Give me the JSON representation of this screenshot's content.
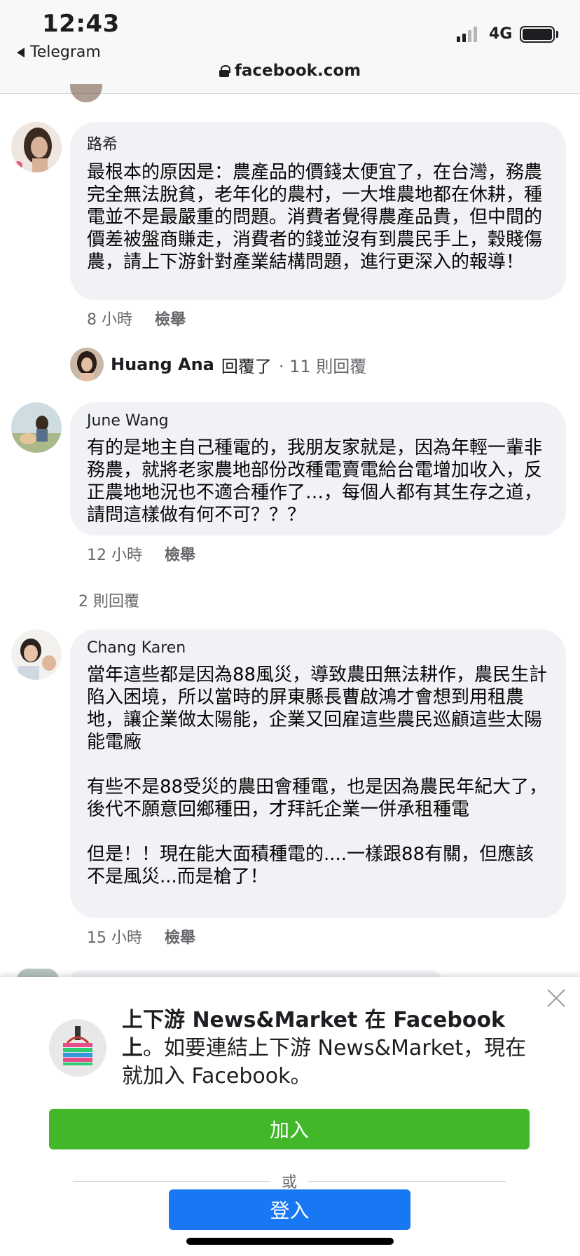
{
  "status_bar": {
    "time": "12:43",
    "back_app": "Telegram",
    "network": "4G"
  },
  "browser": {
    "url": "facebook.com"
  },
  "comments": [
    {
      "author": "路希",
      "text": "最根本的原因是：農產品的價錢太便宜了，在台灣，務農完全無法脫貧，老年化的農村，一大堆農地都在休耕，種電並不是最嚴重的問題。消費者覺得農產品貴，但中間的價差被盤商賺走，消費者的錢並沒有到農民手上，穀賤傷農，請上下游針對產業結構問題，進行更深入的報導！",
      "time": "8 小時",
      "report": "檢舉"
    },
    {
      "author": "June Wang",
      "text": "有的是地主自己種電的，我朋友家就是，因為年輕一輩非務農，就將老家農地部份改種電賣電給台電增加收入，反正農地地況也不適合種作了…，每個人都有其生存之道，請問這樣做有何不可？？？",
      "time": "12 小時",
      "report": "檢舉"
    },
    {
      "author": "Chang Karen",
      "text": "當年這些都是因為88風災，導致農田無法耕作，農民生計陷入困境，所以當時的屏東縣長曹啟鴻才會想到用租農地，讓企業做太陽能，企業又回雇這些農民巡顧這些太陽能電廠\n\n有些不是88受災的農田會種電，也是因為農民年紀大了，後代不願意回鄉種田，才拜託企業一併承租種電\n\n但是！！現在能大面積種電的....一樣跟88有關，但應該不是風災...而是槍了！",
      "time": "15 小時",
      "report": "檢舉"
    }
  ],
  "reply_summary": {
    "name": "Huang Ana",
    "action": "回覆了",
    "count": "· 11 則回覆"
  },
  "more_replies": "2 則回覆",
  "login_sheet": {
    "title_bold": "上下游 News&Market 在 Facebook 上",
    "message": "。如要連結上下游 News&Market，現在就加入 Facebook。",
    "join_label": "加入",
    "or_label": "或",
    "login_label": "登入"
  }
}
